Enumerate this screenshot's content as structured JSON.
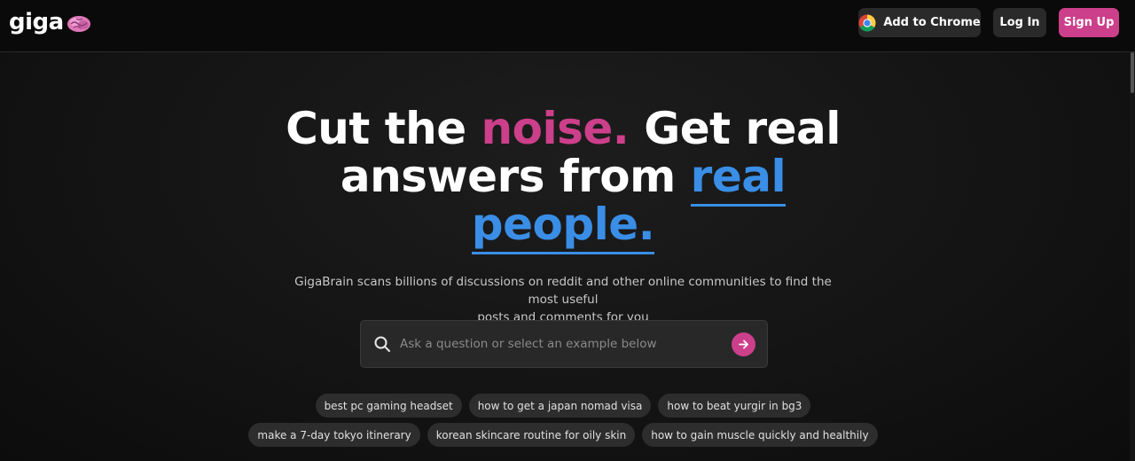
{
  "header": {
    "logo_text": "giga",
    "logo_icon": "brain-icon",
    "add_to_chrome_label": "Add to Chrome",
    "chrome_icon": "chrome-icon",
    "login_label": "Log In",
    "signup_label": "Sign Up"
  },
  "hero": {
    "line1_part1": "Cut the ",
    "line1_highlight": "noise.",
    "line1_part2": " Get real",
    "line2_part1": "answers from ",
    "line2_highlight": "real",
    "line3_highlight": "people.",
    "subtitle_line1": "GigaBrain scans billions of discussions on reddit and other online communities to find the most useful",
    "subtitle_line2": "posts and comments for you"
  },
  "search": {
    "placeholder": "Ask a question or select an example below",
    "value": ""
  },
  "examples": {
    "row1": [
      "best pc gaming headset",
      "how to get a japan nomad visa",
      "how to beat yurgir in bg3"
    ],
    "row2": [
      "make a 7-day tokyo itinerary",
      "korean skincare routine for oily skin",
      "how to gain muscle quickly and healthily"
    ]
  },
  "colors": {
    "accent_pink": "#cc3f8a",
    "accent_blue": "#3a8ee6",
    "background": "#141414"
  }
}
